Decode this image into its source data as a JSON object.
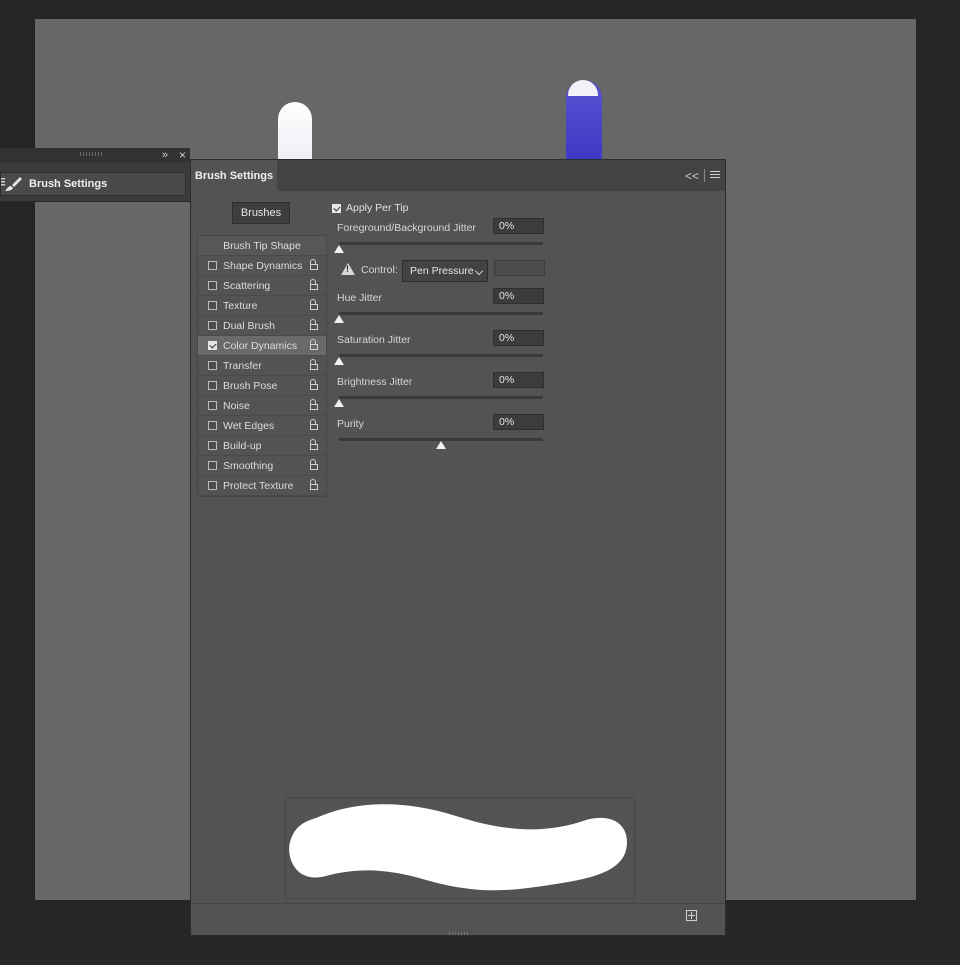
{
  "mini_panel": {
    "expand_glyph": "»",
    "close_glyph": "×",
    "title": "Brush Settings"
  },
  "panel": {
    "tab_label": "Brush Settings",
    "collapse_glyph": "<<",
    "brushes_button": "Brushes",
    "left_list": [
      {
        "label": "Brush Tip Shape",
        "header": true
      },
      {
        "label": "Shape Dynamics",
        "checked": false
      },
      {
        "label": "Scattering",
        "checked": false
      },
      {
        "label": "Texture",
        "checked": false
      },
      {
        "label": "Dual Brush",
        "checked": false
      },
      {
        "label": "Color Dynamics",
        "checked": true,
        "selected": true
      },
      {
        "label": "Transfer",
        "checked": false
      },
      {
        "label": "Brush Pose",
        "checked": false
      },
      {
        "label": "Noise",
        "checked": false
      },
      {
        "label": "Wet Edges",
        "checked": false
      },
      {
        "label": "Build-up",
        "checked": false
      },
      {
        "label": "Smoothing",
        "checked": false
      },
      {
        "label": "Protect Texture",
        "checked": false
      }
    ],
    "apply_per_tip": {
      "label": "Apply Per Tip",
      "checked": true
    },
    "control": {
      "label": "Control:",
      "value": "Pen Pressure"
    },
    "params": {
      "fg_bg_jitter": {
        "label": "Foreground/Background Jitter",
        "value": "0%",
        "level": 0
      },
      "hue_jitter": {
        "label": "Hue Jitter",
        "value": "0%",
        "level": 0
      },
      "saturation_jitter": {
        "label": "Saturation Jitter",
        "value": "0%",
        "level": 0
      },
      "brightness_jitter": {
        "label": "Brightness Jitter",
        "value": "0%",
        "level": 0
      },
      "purity": {
        "label": "Purity",
        "value": "0%",
        "level": 0.5
      }
    }
  },
  "colors": {
    "canvas": "#676767",
    "panel": "#535353",
    "stroke_blue": "#4a42cc"
  }
}
